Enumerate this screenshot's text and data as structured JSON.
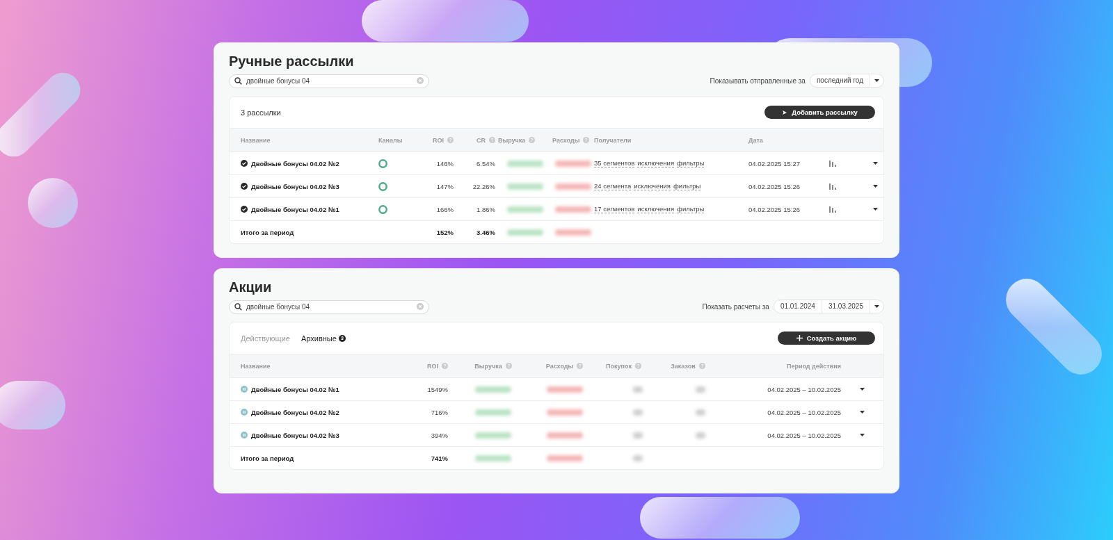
{
  "mailings": {
    "title": "Ручные рассылки",
    "search": {
      "value": "двойные бонусы 04"
    },
    "period_filter": {
      "label": "Показывать отправленные за",
      "values": [
        "последний год"
      ]
    },
    "count": "3 рассылки",
    "action_button": {
      "label": "Добавить рассылку"
    },
    "columns": [
      {
        "label": "Название",
        "kind": "name"
      },
      {
        "label": "Каналы",
        "kind": "channel"
      },
      {
        "label": "ROI",
        "help": true,
        "kind": "num"
      },
      {
        "label": "CR",
        "help": true,
        "kind": "num"
      },
      {
        "label": "Выручка",
        "help": true,
        "kind": "gain"
      },
      {
        "label": "Расходы",
        "help": true,
        "kind": "loss"
      },
      {
        "label": "Получатели",
        "kind": "links"
      },
      {
        "label": "Дата",
        "kind": "text"
      },
      {
        "kind": "stats"
      },
      {
        "kind": "caret"
      }
    ],
    "rows": [
      {
        "kind": "sent",
        "cells": [
          "Двойные бонусы 04.02 №2",
          "",
          "146%",
          "6.54%",
          "",
          "",
          [
            "35 сегментов",
            "исключения",
            "фильтры"
          ],
          "04.02.2025 15:27",
          "",
          ""
        ]
      },
      {
        "kind": "sent",
        "cells": [
          "Двойные бонусы 04.02 №3",
          "",
          "147%",
          "22.26%",
          "",
          "",
          [
            "24 сегмента",
            "исключения",
            "фильтры"
          ],
          "04.02.2025 15:26",
          "",
          ""
        ]
      },
      {
        "kind": "sent",
        "cells": [
          "Двойные бонусы 04.02 №1",
          "",
          "166%",
          "1.86%",
          "",
          "",
          [
            "17 сегментов",
            "исключения",
            "фильтры"
          ],
          "04.02.2025 15:26",
          "",
          ""
        ]
      }
    ],
    "total": {
      "label": "Итого за период",
      "cells": [
        "",
        "",
        "152%",
        "3.46%",
        "",
        "",
        "",
        "",
        "",
        ""
      ]
    }
  },
  "promotions": {
    "title": "Акции",
    "search": {
      "value": "двойные бонусы 04"
    },
    "period_filter": {
      "label": "Показать расчеты за",
      "values": [
        "01.01.2024",
        "31.03.2025"
      ]
    },
    "tabs": [
      {
        "label": "Действующие",
        "selected": false
      },
      {
        "label": "Архивные",
        "badge": "3",
        "selected": true
      }
    ],
    "action_button": {
      "label": "Создать акцию"
    },
    "columns": [
      {
        "label": "Название",
        "kind": "name"
      },
      {
        "label": "ROI",
        "help": true,
        "kind": "num"
      },
      {
        "label": "Выручка",
        "help": true,
        "kind": "gain"
      },
      {
        "label": "Расходы",
        "help": true,
        "kind": "loss"
      },
      {
        "label": "Покупок",
        "help": true,
        "kind": "count"
      },
      {
        "label": "Заказов",
        "help": true,
        "kind": "count"
      },
      {
        "label": "Период действия",
        "kind": "num"
      },
      {
        "kind": "caret"
      }
    ],
    "rows": [
      {
        "kind": "archived",
        "cells": [
          "Двойные бонусы 04.02 №1",
          "1549%",
          "",
          "",
          "",
          "",
          "04.02.2025 – 10.02.2025",
          ""
        ]
      },
      {
        "kind": "archived",
        "cells": [
          "Двойные бонусы 04.02 №2",
          "716%",
          "",
          "",
          "",
          "",
          "04.02.2025 – 10.02.2025",
          ""
        ]
      },
      {
        "kind": "archived",
        "cells": [
          "Двойные бонусы 04.02 №3",
          "394%",
          "",
          "",
          "",
          "",
          "04.02.2025 – 10.02.2025",
          ""
        ]
      }
    ],
    "total": {
      "label": "Итого за период",
      "cells": [
        "",
        "741%",
        "",
        "",
        "",
        "",
        "",
        ""
      ]
    }
  }
}
